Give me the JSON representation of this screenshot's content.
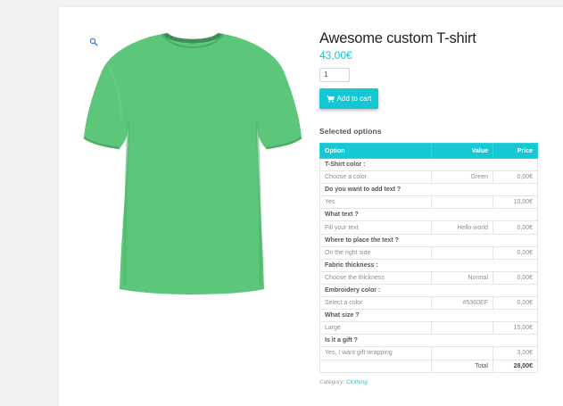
{
  "product": {
    "title": "Awesome custom T-shirt",
    "price": "43,00€",
    "quantity": "1",
    "add_to_cart_label": "Add to cart",
    "color": "#5cc77b"
  },
  "selected_options": {
    "heading": "Selected options",
    "columns": [
      "Option",
      "Value",
      "Price"
    ],
    "groups": [
      {
        "title": "T-Shirt color :",
        "row": {
          "option": "Choose a color",
          "value": "Green",
          "price": "0,00€"
        }
      },
      {
        "title": "Do you want to add text ?",
        "row": {
          "option": "Yes",
          "value": "",
          "price": "10,00€"
        }
      },
      {
        "title": "What text ?",
        "row": {
          "option": "Fill your text",
          "value": "Hello world",
          "price": "0,00€"
        }
      },
      {
        "title": "Where to place the text ?",
        "row": {
          "option": "On the right side",
          "value": "",
          "price": "0,00€"
        }
      },
      {
        "title": "Fabric thickness :",
        "row": {
          "option": "Choose the thickness",
          "value": "Normal",
          "price": "0,00€"
        }
      },
      {
        "title": "Embroidery color :",
        "row": {
          "option": "Select a color",
          "value": "#5360EF",
          "price": "0,00€"
        }
      },
      {
        "title": "What size ?",
        "row": {
          "option": "Large",
          "value": "",
          "price": "15,00€"
        }
      },
      {
        "title": "Is it a gift ?",
        "row": {
          "option": "Yes, I want gift wrapping",
          "value": "",
          "price": "3,00€"
        }
      }
    ],
    "total_label": "Total",
    "total_value": "28,00€"
  },
  "category": {
    "label": "Category:",
    "link": "Clothing"
  },
  "colors": {
    "accent": "#16c7d4",
    "shirt": "#5cc77b"
  },
  "icons": {
    "zoom": "zoom-icon",
    "cart": "cart-icon"
  }
}
